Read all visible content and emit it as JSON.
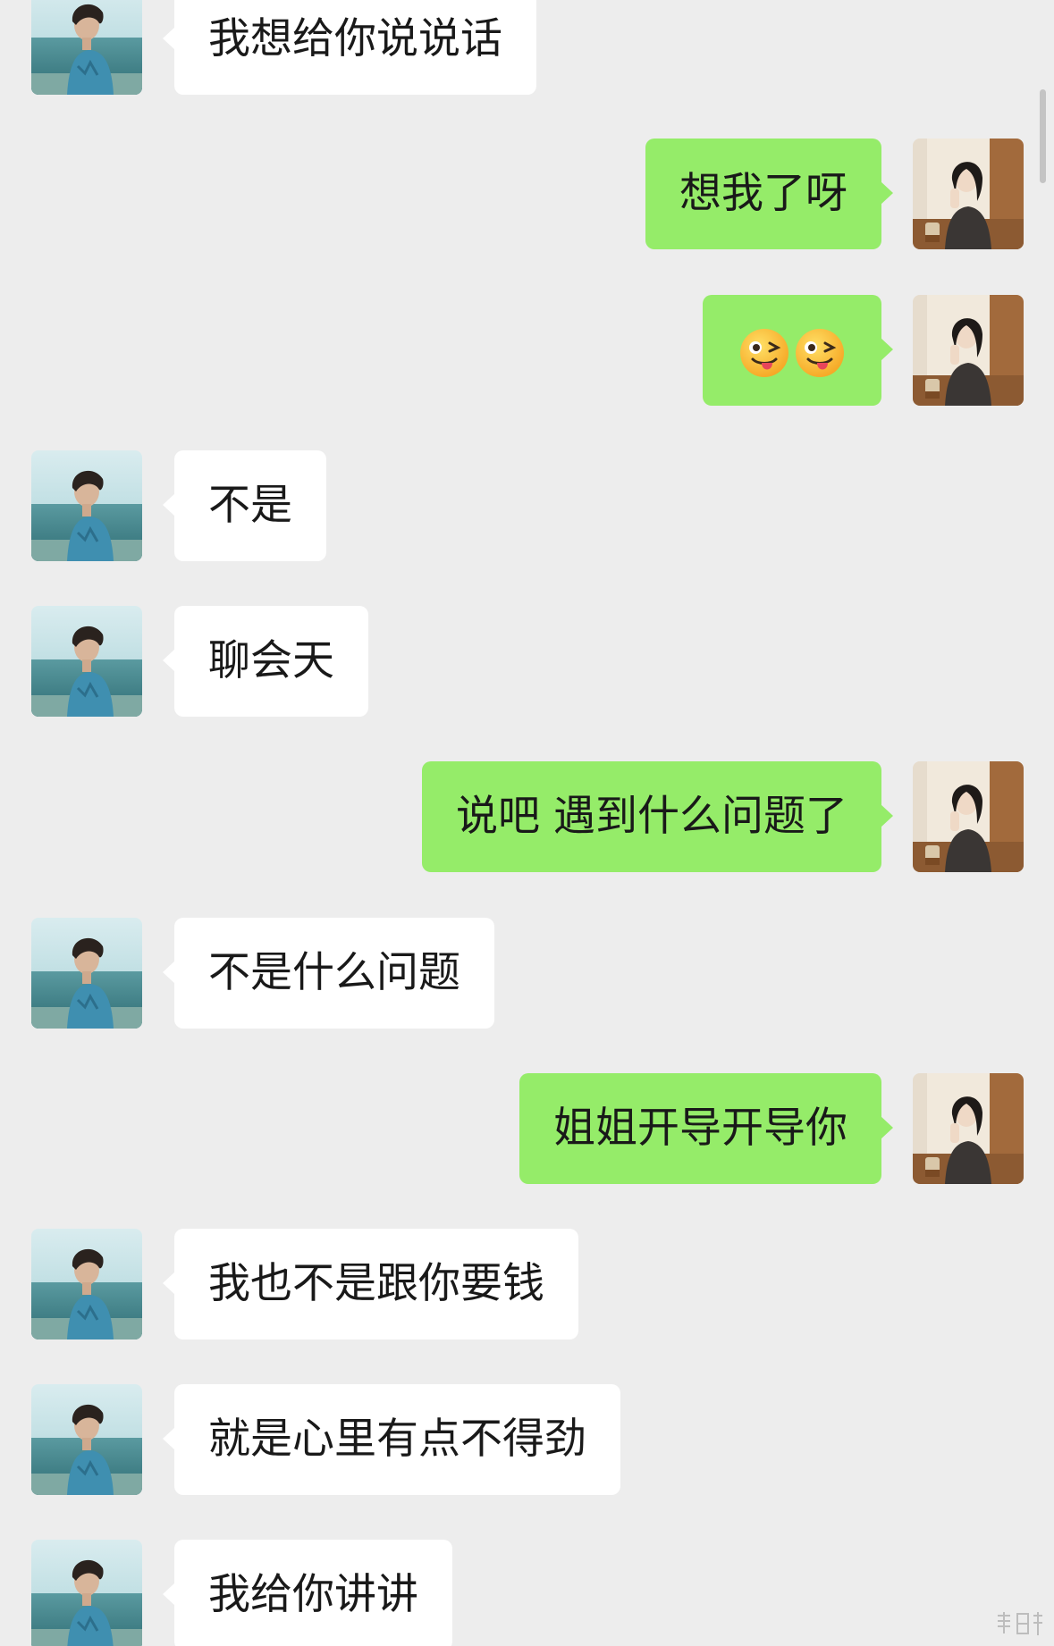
{
  "messages": [
    {
      "side": "left",
      "text": "我想给你说说话"
    },
    {
      "side": "right",
      "text": "想我了呀"
    },
    {
      "side": "right",
      "emoji": [
        "winking-tongue-face",
        "winking-tongue-face"
      ]
    },
    {
      "side": "left",
      "text": "不是"
    },
    {
      "side": "left",
      "text": "聊会天"
    },
    {
      "side": "right",
      "text": "说吧 遇到什么问题了"
    },
    {
      "side": "left",
      "text": "不是什么问题"
    },
    {
      "side": "right",
      "text": "姐姐开导开导你"
    },
    {
      "side": "left",
      "text": "我也不是跟你要钱"
    },
    {
      "side": "left",
      "text": "就是心里有点不得劲"
    },
    {
      "side": "left",
      "text": "我给你讲讲"
    }
  ],
  "avatars": {
    "left": "photo-man-by-sea",
    "right": "photo-woman-in-cafe"
  },
  "colors": {
    "background": "#ededed",
    "incoming_bubble": "#ffffff",
    "outgoing_bubble": "#95ec69",
    "text": "#191919"
  }
}
